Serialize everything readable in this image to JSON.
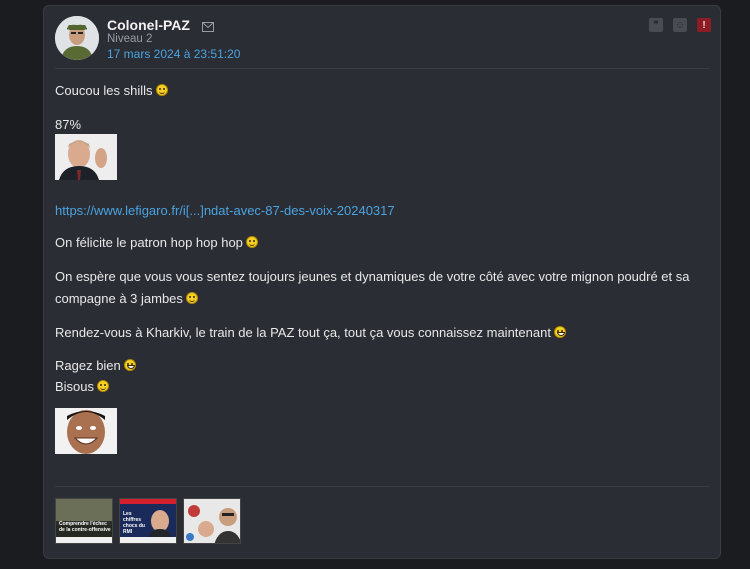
{
  "post": {
    "username": "Colonel-PAZ",
    "level": "Niveau 2",
    "date": "17 mars 2024 à 23:51:20",
    "header_icons": [
      "quote-icon",
      "smiley-icon",
      "report-icon"
    ],
    "lines": {
      "greeting": "Coucou les shills",
      "percent": "87%",
      "link": "https://www.lefigaro.fr/i[...]ndat-avec-87-des-voix-20240317",
      "congrats": "On félicite le patron hop hop hop",
      "hope_line1": "On espère que vous vous sentez toujours jeunes et dynamiques de votre côté avec votre mignon poudré et sa",
      "hope_line2": "compagne à 3 jambes",
      "kharkiv": "Rendez-vous à Kharkiv, le train de la PAZ tout ça, tout ça vous connaissez maintenant",
      "ragez": "Ragez bien",
      "bisous": "Bisous"
    },
    "thumbnails": [
      {
        "caption": "Comprendre l'échec de la contre-offensive"
      },
      {
        "caption": "Les chiffres chocs du RMI"
      },
      {
        "caption": ""
      }
    ]
  },
  "colors": {
    "background": "#1b1c20",
    "card": "#2b2d34",
    "link": "#4aa3e0",
    "alert": "#8b1e24"
  }
}
